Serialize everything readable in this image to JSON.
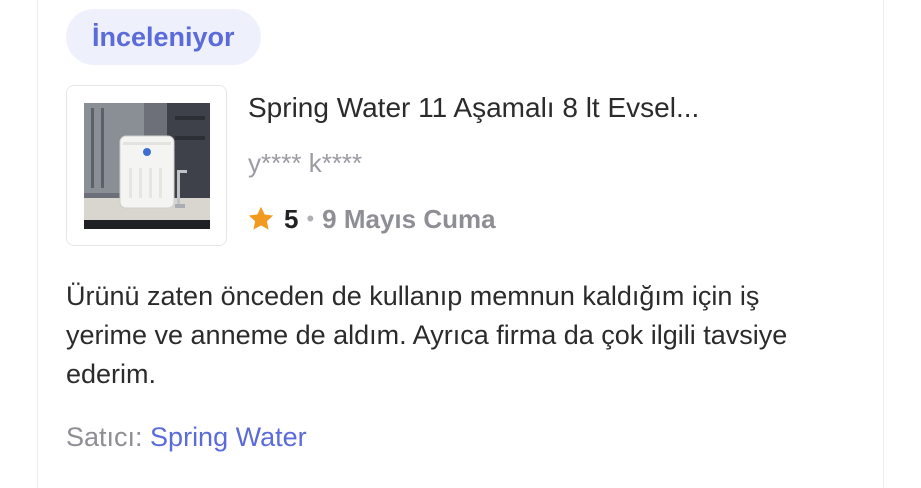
{
  "status_badge": "İnceleniyor",
  "product": {
    "title": "Spring Water 11 Aşamalı 8 lt Evsel...",
    "image_alt": "water-purifier-product-photo"
  },
  "review": {
    "reviewer": "y**** k****",
    "rating": "5",
    "separator": "•",
    "date": "9 Mayıs Cuma",
    "text": "Ürünü zaten önceden de kullanıp memnun kaldığım için iş yerime ve anneme de aldım. Ayrıca firma da çok ilgili tavsiye ederim."
  },
  "seller": {
    "label": "Satıcı:",
    "name": "Spring Water"
  },
  "colors": {
    "accent": "#5b6bd9",
    "badge_bg": "#eef0fc",
    "star": "#f29a1f"
  }
}
